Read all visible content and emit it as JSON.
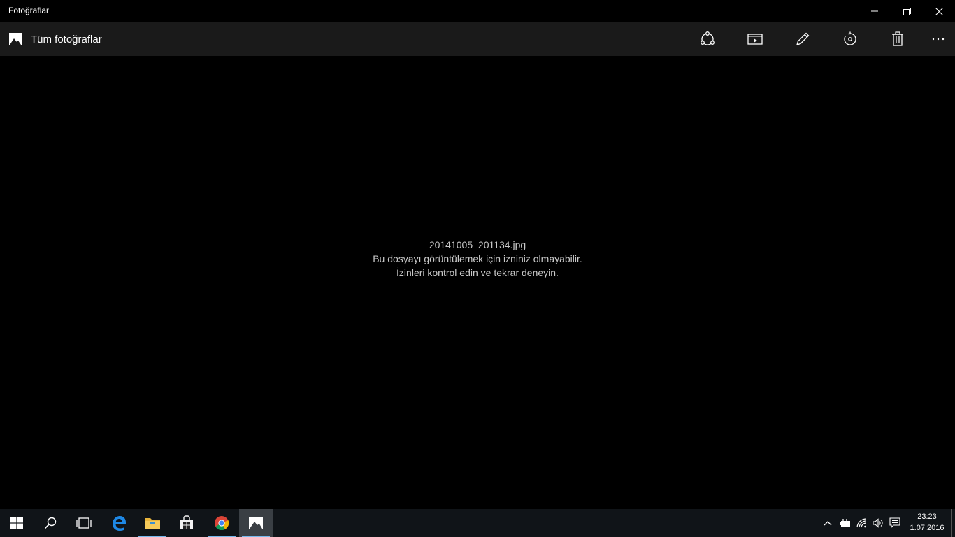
{
  "window": {
    "title": "Fotoğraflar"
  },
  "commandbar": {
    "gallery_label": "Tüm fotoğraflar"
  },
  "viewer": {
    "filename": "20141005_201134.jpg",
    "message": "Bu dosyayı görüntülemek için izniniz olmayabilir. İzinleri kontrol edin ve tekrar deneyin."
  },
  "taskbar": {
    "time": "23:23",
    "date": "1.07.2016"
  },
  "colors": {
    "commandbar_bg": "#1a1a1a",
    "taskbar_bg": "#101418",
    "accent": "#76b9ed"
  }
}
